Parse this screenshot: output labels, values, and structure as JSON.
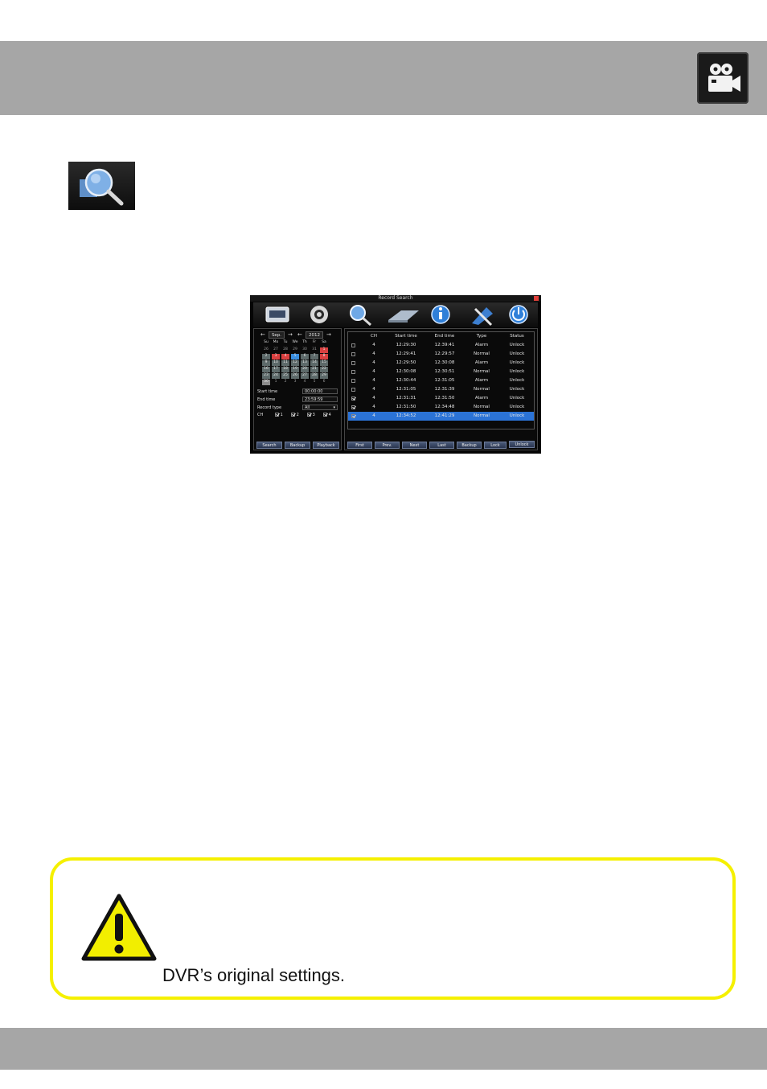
{
  "colors": {
    "header_band": "#a6a6a6",
    "footer_band": "#a6a6a6",
    "warning_border": "#f5f000",
    "selection": "#2b73d6"
  },
  "header": {
    "icon": "video-camera-icon"
  },
  "section_icon": "record-search-icon",
  "dvr": {
    "title": "Record Search",
    "menu_icons": [
      "system-icon",
      "settings-icon",
      "search-icon",
      "disk-icon",
      "info-icon",
      "tools-icon",
      "power-icon"
    ],
    "calendar": {
      "month": "Sep.",
      "year": "2012",
      "weekdays": [
        "Su",
        "Mo",
        "Tu",
        "We",
        "Th",
        "Fr",
        "Sa"
      ],
      "weeks": [
        [
          "26",
          "27",
          "28",
          "29",
          "30",
          "31",
          "1"
        ],
        [
          "2",
          "3",
          "4",
          "5",
          "6",
          "7",
          "8"
        ],
        [
          "9",
          "10",
          "11",
          "12",
          "13",
          "14",
          "15"
        ],
        [
          "16",
          "17",
          "18",
          "19",
          "20",
          "21",
          "22"
        ],
        [
          "23",
          "24",
          "25",
          "26",
          "27",
          "28",
          "29"
        ],
        [
          "30",
          "1",
          "2",
          "3",
          "4",
          "5",
          "6"
        ]
      ]
    },
    "form": {
      "start_label": "Start time",
      "start_value": "00:00:00",
      "end_label": "End time",
      "end_value": "23:59:59",
      "type_label": "Record type",
      "type_value": "All",
      "ch_label": "CH",
      "channels": [
        "1",
        "2",
        "3",
        "4"
      ]
    },
    "left_buttons": [
      "Search",
      "Backup",
      "Playback"
    ],
    "table": {
      "headers": [
        "CH",
        "Start time",
        "End time",
        "Type",
        "Status"
      ],
      "rows": [
        {
          "checked": false,
          "ch": "4",
          "start": "12:29:30",
          "end": "12:39:41",
          "type": "Alarm",
          "status": "Unlock"
        },
        {
          "checked": false,
          "ch": "4",
          "start": "12:29:41",
          "end": "12:29:57",
          "type": "Normal",
          "status": "Unlock"
        },
        {
          "checked": false,
          "ch": "4",
          "start": "12:29:50",
          "end": "12:30:08",
          "type": "Alarm",
          "status": "Unlock"
        },
        {
          "checked": false,
          "ch": "4",
          "start": "12:30:08",
          "end": "12:30:51",
          "type": "Normal",
          "status": "Unlock"
        },
        {
          "checked": false,
          "ch": "4",
          "start": "12:30:44",
          "end": "12:31:05",
          "type": "Alarm",
          "status": "Unlock"
        },
        {
          "checked": false,
          "ch": "4",
          "start": "12:31:05",
          "end": "12:31:39",
          "type": "Normal",
          "status": "Unlock"
        },
        {
          "checked": true,
          "ch": "4",
          "start": "12:31:31",
          "end": "12:31:50",
          "type": "Alarm",
          "status": "Unlock"
        },
        {
          "checked": true,
          "ch": "4",
          "start": "12:31:50",
          "end": "12:34:48",
          "type": "Normal",
          "status": "Unlock"
        },
        {
          "checked": true,
          "ch": "4",
          "start": "12:34:52",
          "end": "12:41:29",
          "type": "Normal",
          "status": "Unlock"
        }
      ]
    },
    "right_buttons": [
      "First",
      "Prev.",
      "Next",
      "Last",
      "Backup",
      "Lock",
      "Unlock"
    ]
  },
  "warning": {
    "icon": "warning-icon",
    "text": "DVR’s original settings."
  }
}
